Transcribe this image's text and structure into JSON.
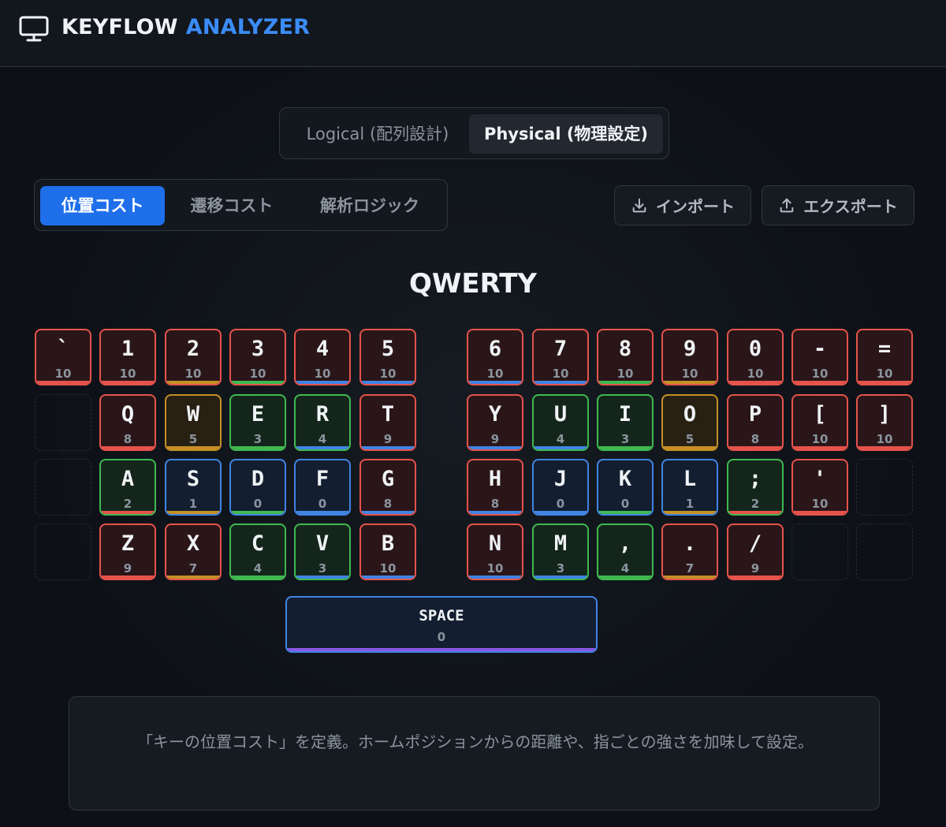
{
  "header": {
    "title_primary": "KEYFLOW",
    "title_accent": "ANALYZER",
    "icon": "monitor-icon"
  },
  "mode_toggle": {
    "logical_label": "Logical (配列設計)",
    "physical_label": "Physical (物理設定)",
    "selected": "physical"
  },
  "cost_tabs": {
    "items": [
      "位置コスト",
      "遷移コスト",
      "解析ロジック"
    ],
    "selected": 0
  },
  "actions": {
    "import_label": "インポート",
    "export_label": "エクスポート",
    "import_icon": "download-icon",
    "export_icon": "upload-icon"
  },
  "layout_name": "QWERTY",
  "colors": {
    "red": "#e5534b",
    "yellow": "#c69026",
    "green": "#3fb950",
    "blue": "#4184e4",
    "purple": "#8957e5",
    "accent": "#1f6feb"
  },
  "keyboard": {
    "rows": [
      {
        "keys": [
          {
            "label": "`",
            "cost": "10",
            "color": "red",
            "bar": "red"
          },
          {
            "label": "1",
            "cost": "10",
            "color": "red",
            "bar": "red"
          },
          {
            "label": "2",
            "cost": "10",
            "color": "red",
            "bar": "yellow"
          },
          {
            "label": "3",
            "cost": "10",
            "color": "red",
            "bar": "green"
          },
          {
            "label": "4",
            "cost": "10",
            "color": "red",
            "bar": "blue"
          },
          {
            "label": "5",
            "cost": "10",
            "color": "red",
            "bar": "blue"
          },
          {
            "label": "6",
            "cost": "10",
            "color": "red",
            "bar": "blue"
          },
          {
            "label": "7",
            "cost": "10",
            "color": "red",
            "bar": "blue"
          },
          {
            "label": "8",
            "cost": "10",
            "color": "red",
            "bar": "green"
          },
          {
            "label": "9",
            "cost": "10",
            "color": "red",
            "bar": "yellow"
          },
          {
            "label": "0",
            "cost": "10",
            "color": "red",
            "bar": "red"
          },
          {
            "label": "-",
            "cost": "10",
            "color": "red",
            "bar": "red"
          },
          {
            "label": "=",
            "cost": "10",
            "color": "red",
            "bar": "red"
          }
        ]
      },
      {
        "keys": [
          {
            "empty": true
          },
          {
            "label": "Q",
            "cost": "8",
            "color": "red",
            "bar": "red"
          },
          {
            "label": "W",
            "cost": "5",
            "color": "yellow",
            "bar": "yellow"
          },
          {
            "label": "E",
            "cost": "3",
            "color": "green",
            "bar": "green"
          },
          {
            "label": "R",
            "cost": "4",
            "color": "green",
            "bar": "blue"
          },
          {
            "label": "T",
            "cost": "9",
            "color": "red",
            "bar": "blue"
          },
          {
            "label": "Y",
            "cost": "9",
            "color": "red",
            "bar": "blue"
          },
          {
            "label": "U",
            "cost": "4",
            "color": "green",
            "bar": "blue"
          },
          {
            "label": "I",
            "cost": "3",
            "color": "green",
            "bar": "green"
          },
          {
            "label": "O",
            "cost": "5",
            "color": "yellow",
            "bar": "yellow"
          },
          {
            "label": "P",
            "cost": "8",
            "color": "red",
            "bar": "red"
          },
          {
            "label": "[",
            "cost": "10",
            "color": "red",
            "bar": "red"
          },
          {
            "label": "]",
            "cost": "10",
            "color": "red",
            "bar": "red"
          }
        ]
      },
      {
        "keys": [
          {
            "empty": true
          },
          {
            "label": "A",
            "cost": "2",
            "color": "green",
            "bar": "red"
          },
          {
            "label": "S",
            "cost": "1",
            "color": "blue",
            "bar": "yellow"
          },
          {
            "label": "D",
            "cost": "0",
            "color": "blue",
            "bar": "green"
          },
          {
            "label": "F",
            "cost": "0",
            "color": "blue",
            "bar": "blue"
          },
          {
            "label": "G",
            "cost": "8",
            "color": "red",
            "bar": "blue"
          },
          {
            "label": "H",
            "cost": "8",
            "color": "red",
            "bar": "blue"
          },
          {
            "label": "J",
            "cost": "0",
            "color": "blue",
            "bar": "blue"
          },
          {
            "label": "K",
            "cost": "0",
            "color": "blue",
            "bar": "green"
          },
          {
            "label": "L",
            "cost": "1",
            "color": "blue",
            "bar": "yellow"
          },
          {
            "label": ";",
            "cost": "2",
            "color": "green",
            "bar": "red"
          },
          {
            "label": "'",
            "cost": "10",
            "color": "red",
            "bar": "red"
          },
          {
            "empty": true
          }
        ]
      },
      {
        "keys": [
          {
            "empty": true
          },
          {
            "label": "Z",
            "cost": "9",
            "color": "red",
            "bar": "red"
          },
          {
            "label": "X",
            "cost": "7",
            "color": "red",
            "bar": "yellow"
          },
          {
            "label": "C",
            "cost": "4",
            "color": "green",
            "bar": "green"
          },
          {
            "label": "V",
            "cost": "3",
            "color": "green",
            "bar": "blue"
          },
          {
            "label": "B",
            "cost": "10",
            "color": "red",
            "bar": "blue"
          },
          {
            "label": "N",
            "cost": "10",
            "color": "red",
            "bar": "blue"
          },
          {
            "label": "M",
            "cost": "3",
            "color": "green",
            "bar": "blue"
          },
          {
            "label": ",",
            "cost": "4",
            "color": "green",
            "bar": "green"
          },
          {
            "label": ".",
            "cost": "7",
            "color": "red",
            "bar": "yellow"
          },
          {
            "label": "/",
            "cost": "9",
            "color": "red",
            "bar": "red"
          },
          {
            "empty": true
          },
          {
            "empty": true
          }
        ]
      }
    ],
    "space": {
      "label": "SPACE",
      "cost": "0",
      "color": "blue",
      "bar": "purple"
    }
  },
  "description": "「キーの位置コスト」を定義。ホームポジションからの距離や、指ごとの強さを加味して設定。"
}
